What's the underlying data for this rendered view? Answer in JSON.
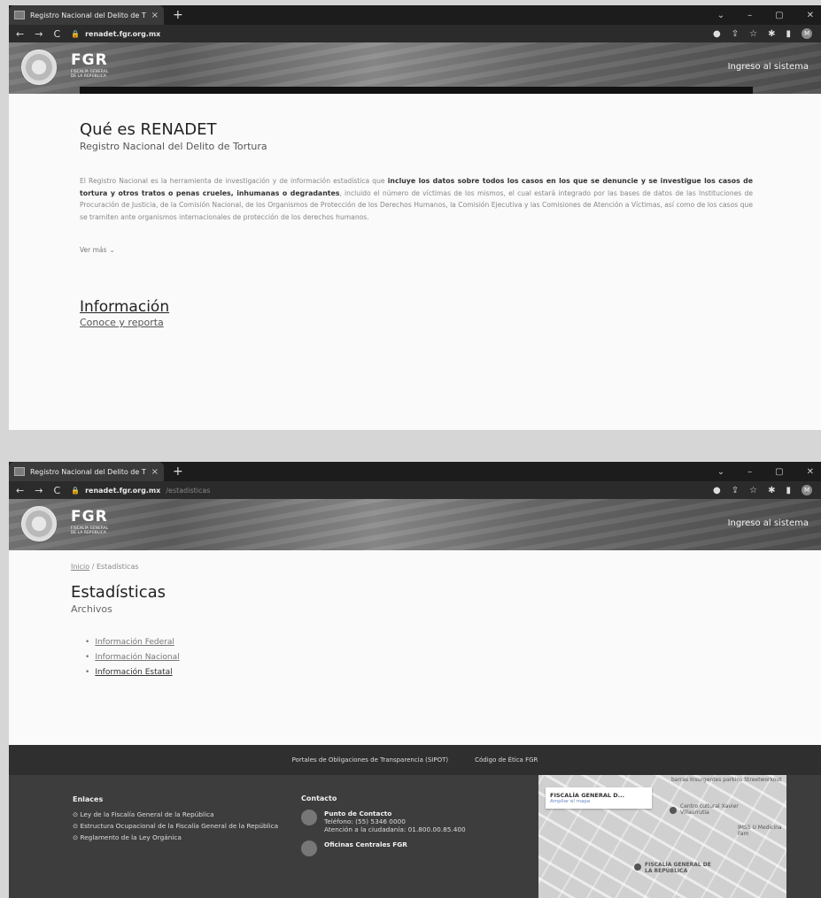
{
  "window1": {
    "tab_title": "Registro Nacional del Delito de T",
    "url_domain": "renadet.fgr.org.mx",
    "url_path": "",
    "logo_text": "FGR",
    "logo_sub": "FISCALÍA GENERAL DE LA REPÚBLICA",
    "login_link": "Ingreso al sistema",
    "title": "Qué es RENADET",
    "subtitle": "Registro Nacional del Delito de Tortura",
    "para_1": "El Registro Nacional es la herramienta de investigación y de información estadística que ",
    "para_bold_1": "incluye los datos sobre todos los casos en los que se denuncie y se investigue los casos de tortura y otros tratos o penas crueles, inhumanas o degradantes",
    "para_2": ", incluido el número de víctimas de los mismos, el cual estará integrado por las bases de datos de las Instituciones de Procuración de Justicia, de la Comisión Nacional, de los Organismos de Protección de los Derechos Humanos, la Comisión Ejecutiva y las Comisiones de Atención a Víctimas, así como de los casos que se tramiten ante organismos internacionales de protección de los derechos humanos.",
    "ver_mas": "Ver más",
    "info_title": "Información",
    "info_sub": "Conoce y reporta"
  },
  "window2": {
    "tab_title": "Registro Nacional del Delito de T",
    "url_domain": "renadet.fgr.org.mx",
    "url_path": "/estadisticas",
    "logo_text": "FGR",
    "logo_sub": "FISCALÍA GENERAL DE LA REPÚBLICA",
    "login_link": "Ingreso al sistema",
    "breadcrumb_home": "Inicio",
    "breadcrumb_sep": " / ",
    "breadcrumb_current": "Estadísticas",
    "title": "Estadísticas",
    "subtitle": "Archivos",
    "files": [
      {
        "label": "Información Federal"
      },
      {
        "label": "Información Nacional"
      },
      {
        "label": "Información Estatal"
      }
    ],
    "footer_links": {
      "sipot": "Portales de Obligaciones de Transparencia (SIPOT)",
      "etica": "Código de Ética FGR"
    },
    "enlaces": {
      "heading": "Enlaces",
      "items": [
        "Ley de la Fiscalía General de la República",
        "Estructura Ocupacional de la Fiscalía General de la República",
        "Reglamento de la Ley Orgánica"
      ]
    },
    "contacto": {
      "heading": "Contacto",
      "punto_title": "Punto de Contacto",
      "punto_tel": "Teléfono: (55) 5346 0000",
      "punto_atencion": "Atención a la ciudadanía: 01.800.00.85.400",
      "oficinas_title": "Oficinas Centrales FGR"
    },
    "map": {
      "card_title": "FISCALÍA GENERAL D...",
      "card_link": "Ampliar el mapa",
      "label_1": "barras Insurgentes parkins Streetworkout",
      "label_2": "Centro cultural Xavier Villaurrutia",
      "label_3": "IMSS U Medicina Fam",
      "label_4": "FISCALÍA GENERAL DE LA REPÚBLICA"
    }
  },
  "browser": {
    "new_tab": "+",
    "close_tab": "×",
    "minimize": "–",
    "maximize": "▢",
    "close": "✕",
    "back": "←",
    "forward": "→",
    "reload": "C",
    "lock": "🔒",
    "avatar": "M"
  },
  "icons": {
    "chevron": "⌄",
    "bullet": "•",
    "circle_arrow": "⊙"
  }
}
